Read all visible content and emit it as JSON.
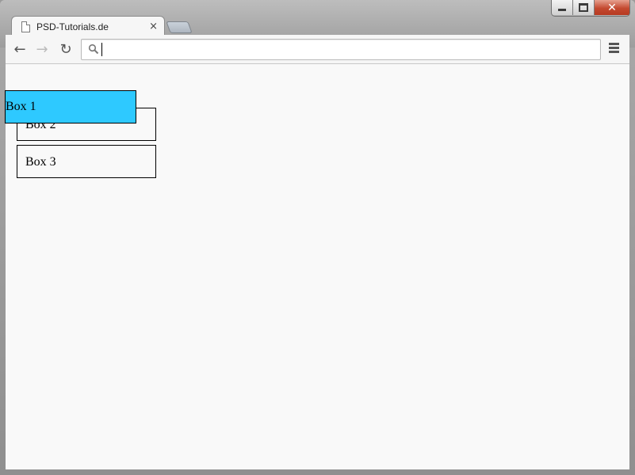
{
  "browser": {
    "tab_title": "PSD-Tutorials.de",
    "tab_close_glyph": "×",
    "omnibox_value": ""
  },
  "window_controls": {
    "minimize_icon": "minimize-icon",
    "maximize_icon": "maximize-icon",
    "close_glyph": "✕"
  },
  "toolbar": {
    "back_glyph": "←",
    "forward_glyph": "→",
    "reload_glyph": "↻"
  },
  "page": {
    "boxes": [
      {
        "label": "Box 1",
        "color": "#2ec9ff"
      },
      {
        "label": "Box 2"
      },
      {
        "label": "Box 3"
      }
    ]
  }
}
